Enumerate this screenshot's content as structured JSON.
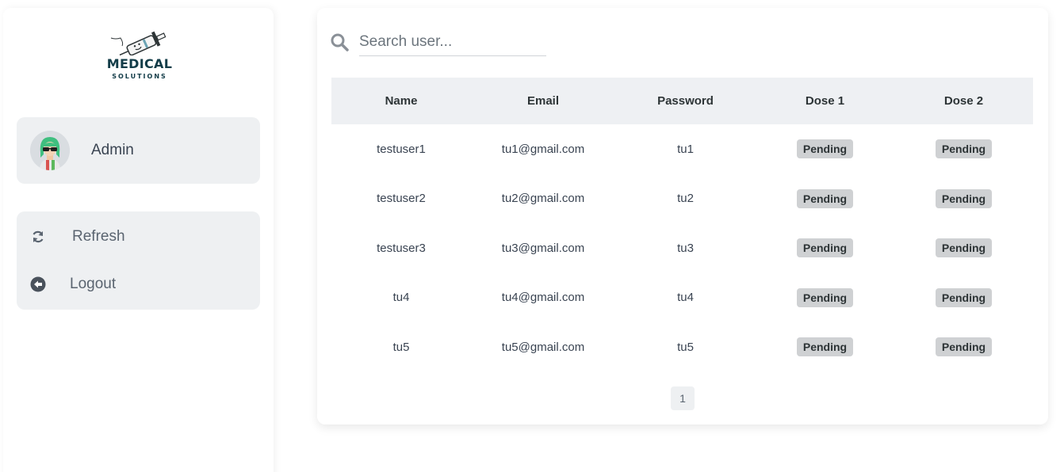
{
  "brand": {
    "title": "MEDICAL",
    "subtitle": "SOLUTIONS",
    "logo_icon": "syringe-icon"
  },
  "profile": {
    "name": "Admin",
    "avatar_icon": "avatar-icon"
  },
  "menu": [
    {
      "label": "Refresh",
      "icon": "refresh-icon"
    },
    {
      "label": "Logout",
      "icon": "logout-icon"
    }
  ],
  "search": {
    "placeholder": "Search user...",
    "value": ""
  },
  "table": {
    "headers": [
      "Name",
      "Email",
      "Password",
      "Dose 1",
      "Dose 2"
    ],
    "rows": [
      {
        "name": "testuser1",
        "email": "tu1@gmail.com",
        "password": "tu1",
        "dose1": "Pending",
        "dose2": "Pending"
      },
      {
        "name": "testuser2",
        "email": "tu2@gmail.com",
        "password": "tu2",
        "dose1": "Pending",
        "dose2": "Pending"
      },
      {
        "name": "testuser3",
        "email": "tu3@gmail.com",
        "password": "tu3",
        "dose1": "Pending",
        "dose2": "Pending"
      },
      {
        "name": "tu4",
        "email": "tu4@gmail.com",
        "password": "tu4",
        "dose1": "Pending",
        "dose2": "Pending"
      },
      {
        "name": "tu5",
        "email": "tu5@gmail.com",
        "password": "tu5",
        "dose1": "Pending",
        "dose2": "Pending"
      }
    ]
  },
  "pagination": {
    "current_page": "1"
  },
  "colors": {
    "brand": "#123c48",
    "card_bg": "#eef0f2",
    "badge_bg": "#cfd1d3",
    "text": "#2d3436"
  }
}
